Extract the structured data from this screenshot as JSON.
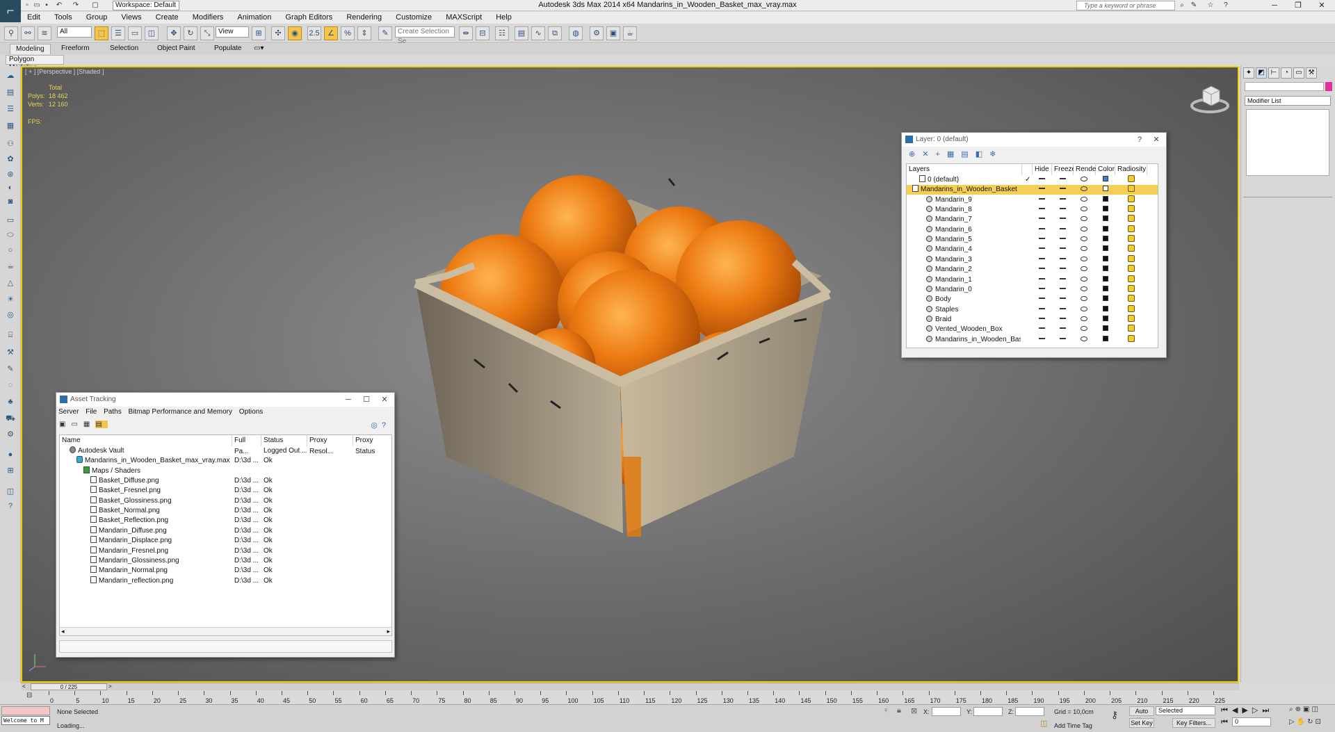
{
  "app": {
    "title": "Autodesk 3ds Max  2014 x64     Mandarins_in_Wooden_Basket_max_vray.max",
    "workspace": "Workspace: Default",
    "search_placeholder": "Type a keyword or phrase"
  },
  "menu": [
    "Edit",
    "Tools",
    "Group",
    "Views",
    "Create",
    "Modifiers",
    "Animation",
    "Graph Editors",
    "Rendering",
    "Customize",
    "MAXScript",
    "Help"
  ],
  "toolbar": {
    "filter": "All",
    "ref_coord": "View",
    "snap_label": "2.5",
    "selection_set_placeholder": "Create Selection Se"
  },
  "ribbon": {
    "tabs": [
      "Modeling",
      "Freeform",
      "Selection",
      "Object Paint",
      "Populate"
    ],
    "active_tab": "Modeling",
    "sub_label": "Polygon Modeling"
  },
  "viewport": {
    "label": "[ + ] [Perspective ] [Shaded ]",
    "stats_header": "Total",
    "polys_label": "Polys:",
    "polys_value": "18 462",
    "verts_label": "Verts:",
    "verts_value": "12 160",
    "fps_label": "FPS:"
  },
  "command_panel": {
    "modifier_list": "Modifier List",
    "accent_color": "#e0309a"
  },
  "layer_window": {
    "title": "Layer: 0 (default)",
    "help": "?",
    "columns": [
      "Layers",
      "Hide",
      "Freeze",
      "Render",
      "Color",
      "Radiosity"
    ],
    "rows": [
      {
        "name": "0 (default)",
        "indent": 1,
        "kind": "layer",
        "current": true,
        "color": "#4a78d6"
      },
      {
        "name": "Mandarins_in_Wooden_Basket",
        "indent": 0,
        "kind": "layer",
        "selected": true,
        "color": "#ffffff"
      },
      {
        "name": "Mandarin_9",
        "indent": 2,
        "kind": "object",
        "color": "#111111"
      },
      {
        "name": "Mandarin_8",
        "indent": 2,
        "kind": "object",
        "color": "#111111"
      },
      {
        "name": "Mandarin_7",
        "indent": 2,
        "kind": "object",
        "color": "#111111"
      },
      {
        "name": "Mandarin_6",
        "indent": 2,
        "kind": "object",
        "color": "#111111"
      },
      {
        "name": "Mandarin_5",
        "indent": 2,
        "kind": "object",
        "color": "#111111"
      },
      {
        "name": "Mandarin_4",
        "indent": 2,
        "kind": "object",
        "color": "#111111"
      },
      {
        "name": "Mandarin_3",
        "indent": 2,
        "kind": "object",
        "color": "#111111"
      },
      {
        "name": "Mandarin_2",
        "indent": 2,
        "kind": "object",
        "color": "#111111"
      },
      {
        "name": "Mandarin_1",
        "indent": 2,
        "kind": "object",
        "color": "#111111"
      },
      {
        "name": "Mandarin_0",
        "indent": 2,
        "kind": "object",
        "color": "#111111"
      },
      {
        "name": "Body",
        "indent": 2,
        "kind": "object",
        "color": "#111111"
      },
      {
        "name": "Staples",
        "indent": 2,
        "kind": "object",
        "color": "#111111"
      },
      {
        "name": "Braid",
        "indent": 2,
        "kind": "object",
        "color": "#111111"
      },
      {
        "name": "Vented_Wooden_Box",
        "indent": 2,
        "kind": "object",
        "color": "#111111"
      },
      {
        "name": "Mandarins_in_Wooden_Basket",
        "indent": 2,
        "kind": "object",
        "color": "#111111"
      }
    ]
  },
  "asset_window": {
    "title": "Asset Tracking",
    "menu": [
      "Server",
      "File",
      "Paths",
      "Bitmap Performance and Memory",
      "Options"
    ],
    "columns": [
      "Name",
      "Full Pa...",
      "Status",
      "Proxy Resol...",
      "Proxy Status"
    ],
    "rows": [
      {
        "name": "Autodesk Vault",
        "indent": 1,
        "path": "",
        "status": "Logged Out ...",
        "kind": "vault"
      },
      {
        "name": "Mandarins_in_Wooden_Basket_max_vray.max",
        "indent": 2,
        "path": "D:\\3d ...",
        "status": "Ok",
        "kind": "max"
      },
      {
        "name": "Maps / Shaders",
        "indent": 3,
        "path": "",
        "status": "",
        "kind": "folder"
      },
      {
        "name": "Basket_Diffuse.png",
        "indent": 4,
        "path": "D:\\3d ...",
        "status": "Ok",
        "kind": "file"
      },
      {
        "name": "Basket_Fresnel.png",
        "indent": 4,
        "path": "D:\\3d ...",
        "status": "Ok",
        "kind": "file"
      },
      {
        "name": "Basket_Glossiness.png",
        "indent": 4,
        "path": "D:\\3d ...",
        "status": "Ok",
        "kind": "file"
      },
      {
        "name": "Basket_Normal.png",
        "indent": 4,
        "path": "D:\\3d ...",
        "status": "Ok",
        "kind": "file"
      },
      {
        "name": "Basket_Reflection.png",
        "indent": 4,
        "path": "D:\\3d ...",
        "status": "Ok",
        "kind": "file"
      },
      {
        "name": "Mandarin_Diffuse.png",
        "indent": 4,
        "path": "D:\\3d ...",
        "status": "Ok",
        "kind": "file"
      },
      {
        "name": "Mandarin_Displace.png",
        "indent": 4,
        "path": "D:\\3d ...",
        "status": "Ok",
        "kind": "file"
      },
      {
        "name": "Mandarin_Fresnel.png",
        "indent": 4,
        "path": "D:\\3d ...",
        "status": "Ok",
        "kind": "file"
      },
      {
        "name": "Mandarin_Glossiness.png",
        "indent": 4,
        "path": "D:\\3d ...",
        "status": "Ok",
        "kind": "file"
      },
      {
        "name": "Mandarin_Normal.png",
        "indent": 4,
        "path": "D:\\3d ...",
        "status": "Ok",
        "kind": "file"
      },
      {
        "name": "Mandarin_reflection.png",
        "indent": 4,
        "path": "D:\\3d ...",
        "status": "Ok",
        "kind": "file"
      }
    ]
  },
  "timeline": {
    "frame_display": "0 / 225",
    "ticks": [
      0,
      5,
      10,
      15,
      20,
      25,
      30,
      35,
      40,
      45,
      50,
      55,
      60,
      65,
      70,
      75,
      80,
      85,
      90,
      95,
      100,
      105,
      110,
      115,
      120,
      125,
      130,
      135,
      140,
      145,
      150,
      155,
      160,
      165,
      170,
      175,
      180,
      185,
      190,
      195,
      200,
      205,
      210,
      215,
      220,
      225
    ],
    "max_frame": 225
  },
  "status": {
    "maxscript_listener": "Welcome to M",
    "selection": "None Selected",
    "prompt": "Loading...",
    "x_label": "X:",
    "y_label": "Y:",
    "z_label": "Z:",
    "grid": "Grid = 10,0cm",
    "add_time_tag": "Add Time Tag",
    "auto_key": "Auto Key",
    "set_key": "Set Key",
    "key_mode": "Selected",
    "key_filters": "Key Filters...",
    "current_frame": "0"
  }
}
